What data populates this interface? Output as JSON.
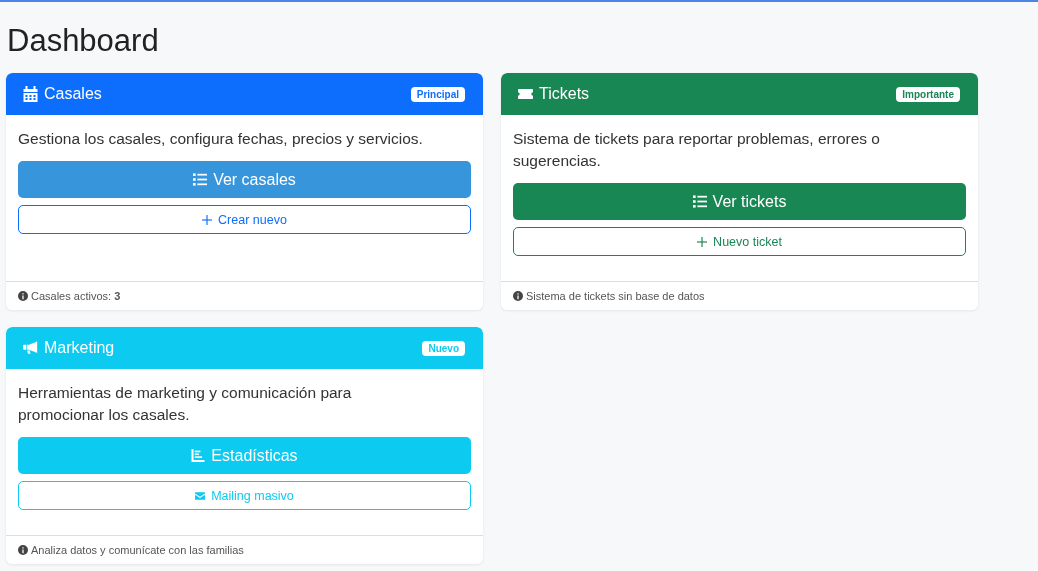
{
  "page_title": "Dashboard",
  "cards": [
    {
      "title": "Casales",
      "badge": "Principal",
      "color": "#0d6efd",
      "description": "Gestiona los casales, configura fechas, precios y servicios.",
      "buttons": [
        {
          "kind": "solid",
          "label": "Ver casales",
          "color": "#3796db"
        },
        {
          "kind": "outline",
          "label": "Crear nuevo"
        }
      ],
      "footer": "Casales activos: **3**"
    },
    {
      "title": "Tickets",
      "badge": "Importante",
      "color": "#198754",
      "description": "Sistema de tickets para reportar problemas, errores o sugerencias.",
      "buttons": [
        {
          "kind": "solid",
          "label": "Ver tickets",
          "color": "#198754"
        },
        {
          "kind": "outline",
          "label": "Nuevo ticket"
        }
      ],
      "footer": "Sistema de tickets sin base de datos"
    },
    {
      "title": "Marketing",
      "badge": "Nuevo",
      "color": "#0dcaf0",
      "description": "Herramientas de marketing y comunicación para promocionar los casales.",
      "buttons": [
        {
          "kind": "solid",
          "label": "Estadísticas",
          "color": "#0dcaf0"
        },
        {
          "kind": "outline",
          "label": "Mailing masivo"
        }
      ],
      "footer": "Analiza datos y comunícate con las familias"
    }
  ]
}
